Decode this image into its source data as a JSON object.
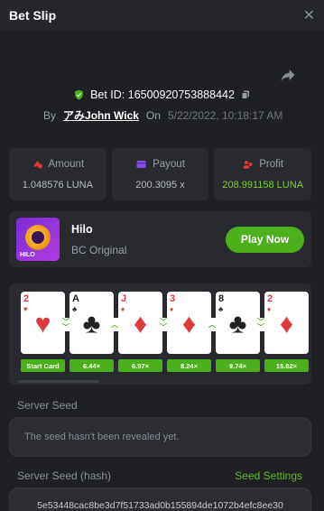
{
  "header": {
    "title": "Bet Slip",
    "close_icon": "close-icon"
  },
  "bet": {
    "id_label": "Bet ID: 16500920753888442",
    "by_label": "By",
    "user": "アみJohn Wick",
    "on_label": "On",
    "date": "5/22/2022, 10:18:17 AM"
  },
  "stats": {
    "amount_label": "Amount",
    "amount_value": "1.048576 LUNA",
    "payout_label": "Payout",
    "payout_value": "200.3095 x",
    "profit_label": "Profit",
    "profit_value": "208.991158 LUNA"
  },
  "game": {
    "name": "Hilo",
    "subtitle": "BC Original",
    "thumb_tag": "HILO",
    "play_label": "Play Now"
  },
  "cards": [
    {
      "rank": "2",
      "suit": "♥",
      "color": "red",
      "mult": "Start Card"
    },
    {
      "rank": "A",
      "suit": "♣",
      "color": "black",
      "mult": "6.44×"
    },
    {
      "rank": "J",
      "suit": "♦",
      "color": "red",
      "mult": "6.97×"
    },
    {
      "rank": "3",
      "suit": "♦",
      "color": "red",
      "mult": "8.24×"
    },
    {
      "rank": "8",
      "suit": "♣",
      "color": "black",
      "mult": "9.74×"
    },
    {
      "rank": "2",
      "suit": "♦",
      "color": "red",
      "mult": "15.82×"
    }
  ],
  "arrows": [
    "down",
    "up",
    "down",
    "up",
    "down"
  ],
  "seeds": {
    "server_seed_label": "Server Seed",
    "server_seed_value": "The seed hasn't been revealed yet.",
    "hash_label": "Server Seed (hash)",
    "settings_label": "Seed Settings",
    "hash_value": "5e53448cac8be3d7f51733ad0b155894de1072b4efc8ee30"
  },
  "colors": {
    "accent_green": "#4caf1c",
    "profit_green": "#7ed321",
    "card_red": "#e0393b"
  }
}
